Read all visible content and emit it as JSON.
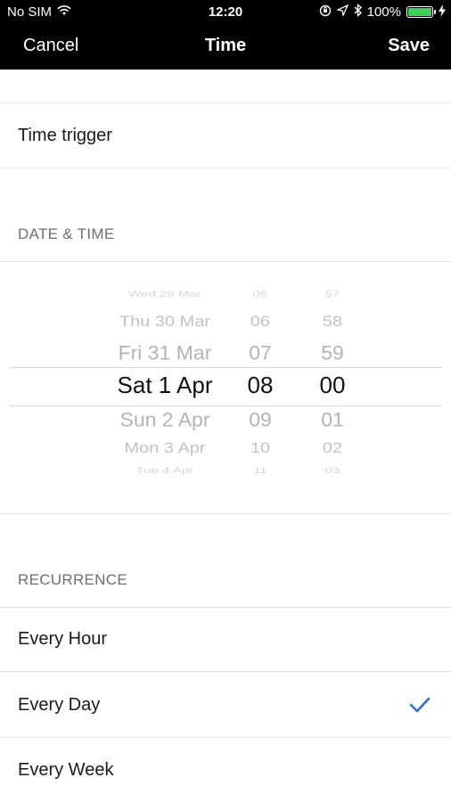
{
  "status_bar": {
    "carrier": "No SIM",
    "time": "12:20",
    "battery": "100%",
    "battery_level": 1.0,
    "icons": [
      "wifi-icon",
      "orientation-lock-icon",
      "location-arrow-icon",
      "bluetooth-icon",
      "battery-icon",
      "charging-icon"
    ]
  },
  "nav": {
    "cancel": "Cancel",
    "title": "Time",
    "save": "Save"
  },
  "trigger": {
    "label": "Time trigger"
  },
  "date_time": {
    "header": "DATE & TIME",
    "picker": {
      "dates": [
        "Wed 29 Mar",
        "Thu 30 Mar",
        "Fri 31 Mar",
        "Sat 1 Apr",
        "Sun 2 Apr",
        "Mon 3 Apr",
        "Tue 4 Apr"
      ],
      "hours": [
        "05",
        "06",
        "07",
        "08",
        "09",
        "10",
        "11"
      ],
      "minutes": [
        "57",
        "58",
        "59",
        "00",
        "01",
        "02",
        "03"
      ],
      "selected_index": 3
    }
  },
  "recurrence": {
    "header": "RECURRENCE",
    "options": [
      {
        "label": "Every Hour",
        "selected": false
      },
      {
        "label": "Every Day",
        "selected": true
      },
      {
        "label": "Every Week",
        "selected": false
      }
    ],
    "accent_color": "#2f6fd6"
  }
}
